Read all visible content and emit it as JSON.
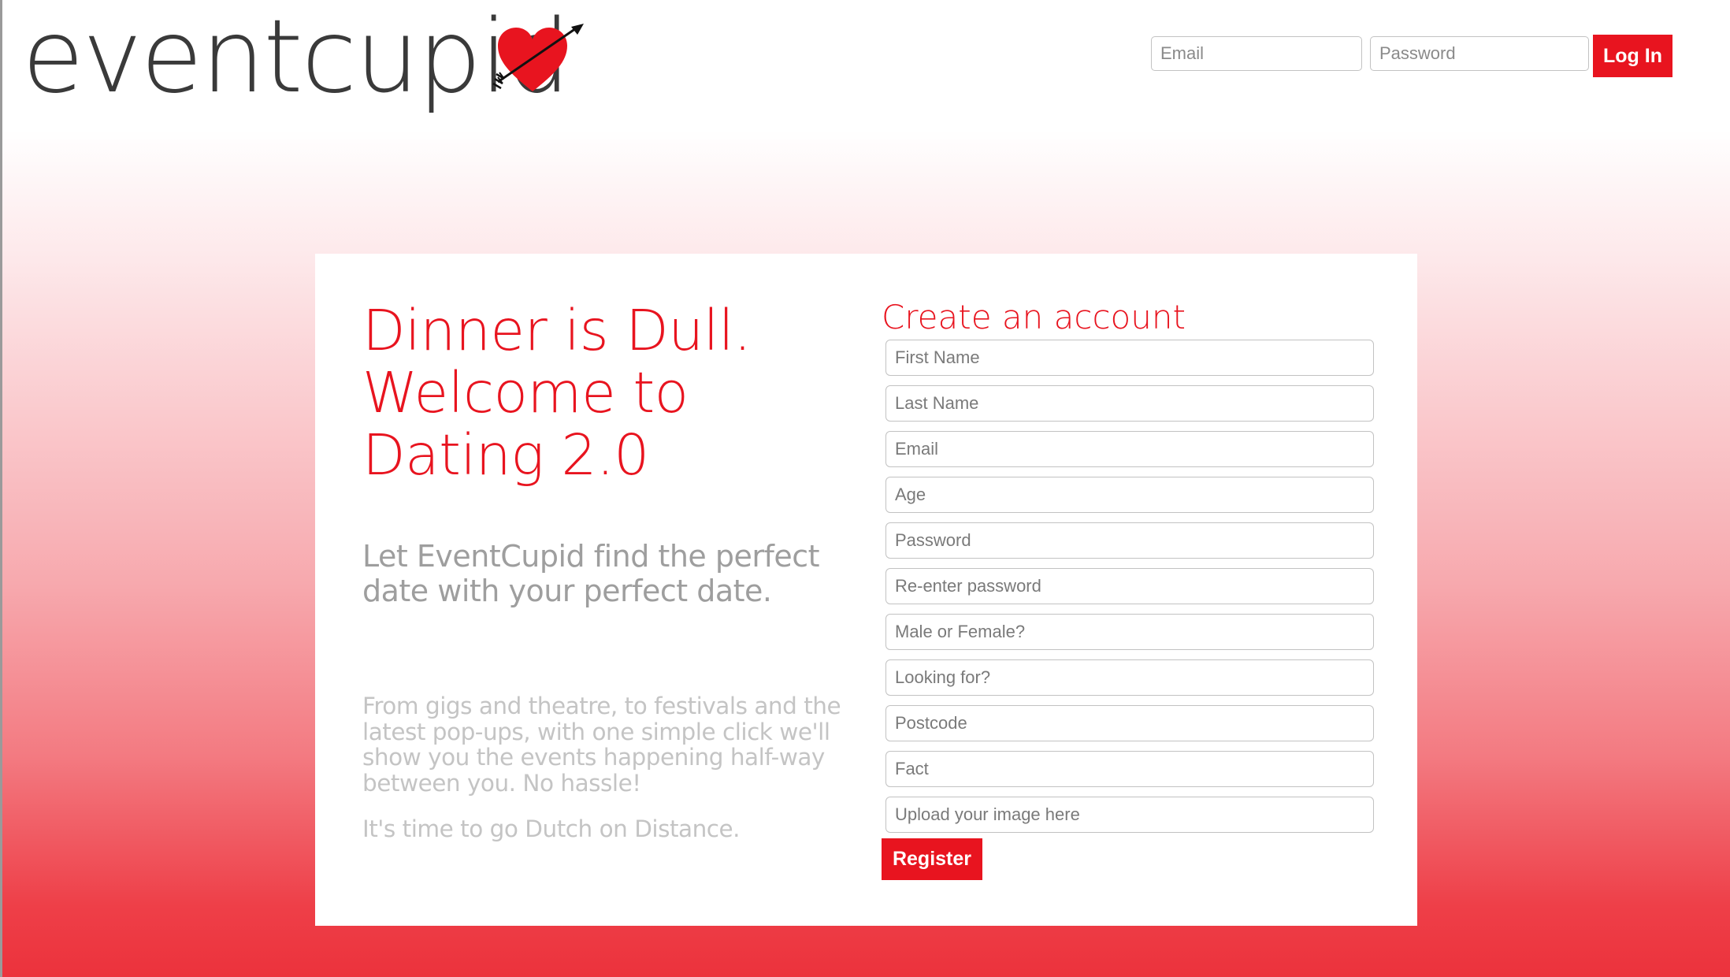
{
  "brand": {
    "logo_text": "eventcupid",
    "icon": "heart-with-arrow-icon",
    "accent_color": "#e8141f"
  },
  "header": {
    "email_placeholder": "Email",
    "password_placeholder": "Password",
    "login_label": "Log In"
  },
  "hero": {
    "headline": "Dinner is Dull.\nWelcome to\nDating 2.0",
    "subhead": "Let EventCupid find the perfect date with your perfect date.",
    "body": "From gigs and theatre, to festivals and the latest pop-ups, with one simple click we'll show you the events happening half-way between you. No hassle!",
    "tagline": "It's time to go Dutch on Distance."
  },
  "register": {
    "title": "Create an account",
    "fields": [
      {
        "name": "first-name",
        "placeholder": "First Name"
      },
      {
        "name": "last-name",
        "placeholder": "Last Name"
      },
      {
        "name": "email",
        "placeholder": "Email"
      },
      {
        "name": "age",
        "placeholder": "Age"
      },
      {
        "name": "password",
        "placeholder": "Password"
      },
      {
        "name": "reenter-password",
        "placeholder": "Re-enter password"
      },
      {
        "name": "gender",
        "placeholder": "Male or Female?"
      },
      {
        "name": "looking-for",
        "placeholder": "Looking for?"
      },
      {
        "name": "postcode",
        "placeholder": "Postcode"
      },
      {
        "name": "fact",
        "placeholder": "Fact"
      },
      {
        "name": "image-upload",
        "placeholder": "Upload your image here"
      }
    ],
    "submit_label": "Register"
  }
}
